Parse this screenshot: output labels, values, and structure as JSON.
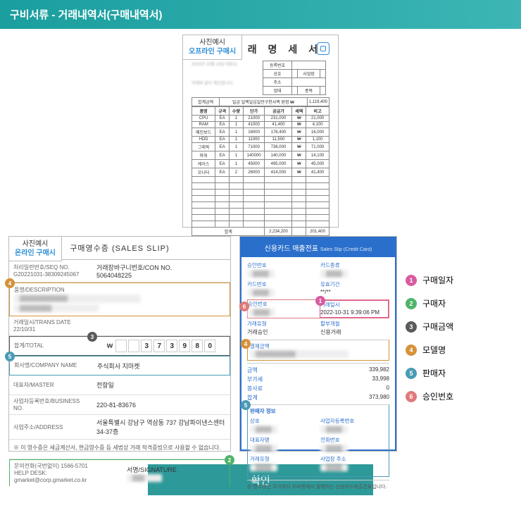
{
  "header": {
    "title": "구비서류 - 거래내역서(구매내역서)"
  },
  "tag_offline": {
    "l1": "사진예시",
    "l2": "오프라인 구매시"
  },
  "tag_online": {
    "l1": "사진예시",
    "l2": "온라인 구매시"
  },
  "top_receipt": {
    "title": "거 래 명 세 서",
    "date_line": "2019년 10월 14일 대표님",
    "sub_line": "아래와 같이 계산합니다",
    "hdr_box": {
      "r1": "등록번호",
      "r2": "상호",
      "r2b": "사업장",
      "r3": "주소",
      "r4": "업태",
      "r4b": "종목"
    },
    "total_row": {
      "label": "합계금액",
      "desc": "일금 일백일십일만구천사백 원정 ₩",
      "amt": "1,119,400"
    },
    "cols": [
      "품명",
      "규격",
      "수량",
      "단가",
      "공급가",
      "세액",
      "비고"
    ],
    "rows": [
      {
        "n": "CPU",
        "s": "EA",
        "q": "1",
        "u": "21000",
        "a": "231,000",
        "t": "₩",
        "r": "21,000"
      },
      {
        "n": "RAM",
        "s": "EA",
        "q": "1",
        "u": "41000",
        "a": "41,400",
        "t": "₩",
        "r": "4,100"
      },
      {
        "n": "메인보드",
        "s": "EA",
        "q": "1",
        "u": "16000",
        "a": "176,400",
        "t": "₩",
        "r": "16,000"
      },
      {
        "n": "HDD",
        "s": "EA",
        "q": "1",
        "u": "11000",
        "a": "11,500",
        "t": "₩",
        "r": "1,100"
      },
      {
        "n": "그래픽",
        "s": "EA",
        "q": "1",
        "u": "71000",
        "a": "738,000",
        "t": "₩",
        "r": "71,000"
      },
      {
        "n": "파워",
        "s": "EA",
        "q": "1",
        "u": "140000",
        "a": "140,000",
        "t": "₩",
        "r": "14,100"
      },
      {
        "n": "케이스",
        "s": "EA",
        "q": "1",
        "u": "45000",
        "a": "495,000",
        "t": "₩",
        "r": "45,000"
      },
      {
        "n": "모니터",
        "s": "EA",
        "q": "2",
        "u": "26000",
        "a": "414,000",
        "t": "₩",
        "r": "41,400"
      }
    ],
    "foot": {
      "l": "합계",
      "a": "2,234,200",
      "t": "201,400"
    }
  },
  "sales_slip": {
    "title": "구매영수증 (SALES SLIP)",
    "rows": {
      "seq": {
        "l1": "처리일련번호/SEQ NO.",
        "l2": "G20221031-38309245067",
        "r1": "거래장바구니번호/CON NO.",
        "r2": "5064048225"
      },
      "desc": {
        "l": "품명/DESCRIPTION"
      },
      "date": {
        "l1": "거래일시/TRANS DATE",
        "l2": "22/10/31"
      },
      "total": {
        "l": "합계/TOTAL",
        "cur": "₩",
        "digits": [
          "",
          "",
          "3",
          "7",
          "3",
          "9",
          "8",
          "0"
        ]
      },
      "company": {
        "l": "회사명/COMPANY NAME",
        "v": "주식회사 지마켓"
      },
      "master": {
        "l": "대표자/MASTER",
        "v": "전항일"
      },
      "bizno": {
        "l": "사업자등록번호/BUSINESS NO.",
        "v": "220-81-83676"
      },
      "addr": {
        "l": "사업주소/ADDRESS",
        "v": "서울특별시 강남구 역삼동 737 강남파이낸스센터 34-37층"
      },
      "note": "※ 이 영수증은 세금계산서, 현금영수증 등 세법상 거래 적격증빙으로 사용할 수 없습니다.",
      "help": {
        "l1": "문의전화(국번없이) 1566-5701",
        "l2": "HELP DESK: gmarket@corp.gmarket.co.kr",
        "r": "서명/SIGNATURE"
      }
    }
  },
  "credit_slip": {
    "title": "신용카드 매출전표",
    "title_sub": "Sales Slip (Credit Card)",
    "rows1": [
      {
        "l": "승인번호",
        "r": "카드종류"
      },
      {
        "l": "카드번호",
        "r": "유효기간",
        "rv": "**/**"
      },
      {
        "l": "승인번호",
        "r": "거래일시",
        "rv": "2022-10-31 9:39:06 PM"
      },
      {
        "l": "거래유형",
        "lv": "거래승인",
        "r": "할부개월",
        "rv": "신용거래"
      }
    ],
    "sec2_l": "결제금액",
    "amounts": [
      {
        "l": "금액",
        "v": "339,982"
      },
      {
        "l": "부가세",
        "v": "33,998"
      },
      {
        "l": "봉사료",
        "v": "0"
      },
      {
        "l": "합계",
        "v": "373,980"
      }
    ],
    "sec3_title": "판매자 정보",
    "rows3": [
      {
        "l": "상호",
        "r": "사업자등록번호"
      },
      {
        "l": "대표자명",
        "r": "전화번호"
      },
      {
        "l": "거래유형",
        "r": "사업장 주소"
      }
    ],
    "note": "본 영수증은 주식회사 지마켓에서 발행하는 신용카드매출전표입니다."
  },
  "legend": [
    {
      "n": "1",
      "cls": "c1",
      "t": "구매일자"
    },
    {
      "n": "2",
      "cls": "c2",
      "t": "구매자"
    },
    {
      "n": "3",
      "cls": "c3",
      "t": "구매금액"
    },
    {
      "n": "4",
      "cls": "c4",
      "t": "모델명"
    },
    {
      "n": "5",
      "cls": "c5",
      "t": "판매자"
    },
    {
      "n": "6",
      "cls": "c6",
      "t": "승인번호"
    }
  ],
  "confirm": "확인"
}
